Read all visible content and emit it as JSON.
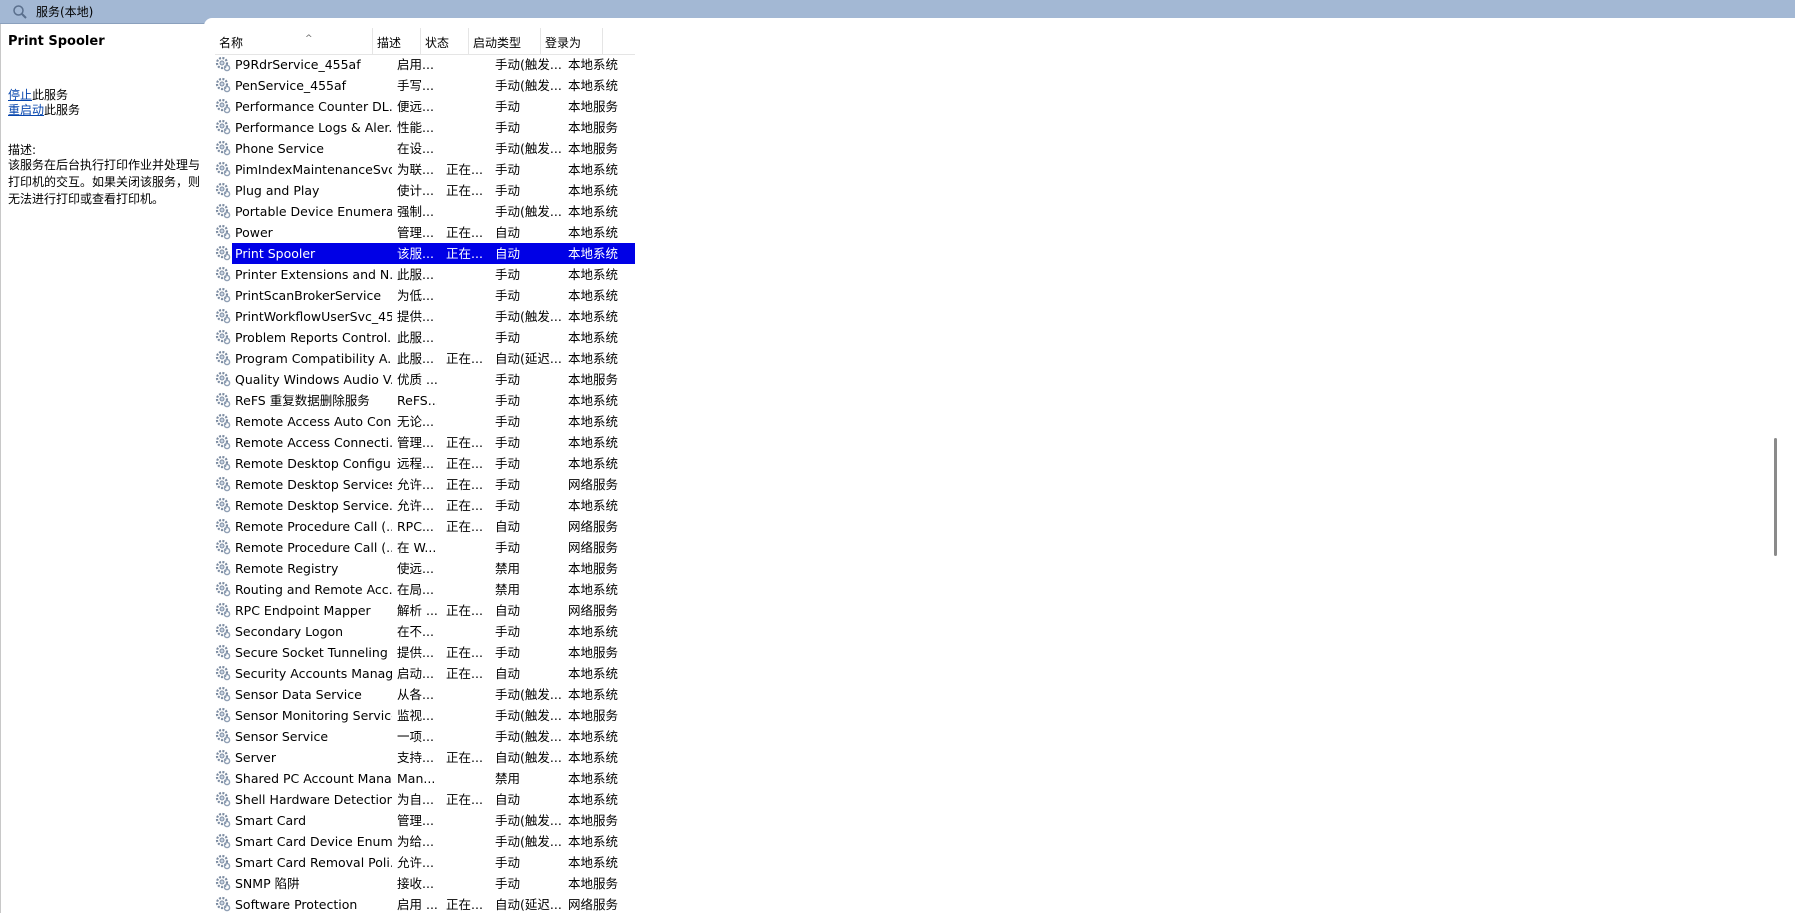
{
  "window": {
    "title": "服务(本地)"
  },
  "left_pane": {
    "title": "Print Spooler",
    "stop_link": "停止",
    "stop_suffix": "此服务",
    "restart_link": "重启动",
    "restart_suffix": "此服务",
    "description_label": "描述:",
    "description": "该服务在后台执行打印作业并处理与打印机的交互。如果关闭该服务，则无法进行打印或查看打印机。"
  },
  "table": {
    "columns": [
      "名称",
      "描述",
      "状态",
      "启动类型",
      "登录为"
    ],
    "selected_index": 9,
    "rows": [
      [
        "P9RdrService_455af",
        "启用...",
        "",
        "手动(触发...",
        "本地系统"
      ],
      [
        "PenService_455af",
        "手写...",
        "",
        "手动(触发...",
        "本地系统"
      ],
      [
        "Performance Counter DL...",
        "便远...",
        "",
        "手动",
        "本地服务"
      ],
      [
        "Performance Logs & Aler...",
        "性能...",
        "",
        "手动",
        "本地服务"
      ],
      [
        "Phone Service",
        "在设...",
        "",
        "手动(触发...",
        "本地服务"
      ],
      [
        "PimIndexMaintenanceSvc...",
        "为联...",
        "正在...",
        "手动",
        "本地系统"
      ],
      [
        "Plug and Play",
        "使计...",
        "正在...",
        "手动",
        "本地系统"
      ],
      [
        "Portable Device Enumera...",
        "强制...",
        "",
        "手动(触发...",
        "本地系统"
      ],
      [
        "Power",
        "管理...",
        "正在...",
        "自动",
        "本地系统"
      ],
      [
        "Print Spooler",
        "该服...",
        "正在...",
        "自动",
        "本地系统"
      ],
      [
        "Printer Extensions and N...",
        "此服...",
        "",
        "手动",
        "本地系统"
      ],
      [
        "PrintScanBrokerService",
        "为低...",
        "",
        "手动",
        "本地系统"
      ],
      [
        "PrintWorkflowUserSvc_45...",
        "提供...",
        "",
        "手动(触发...",
        "本地系统"
      ],
      [
        "Problem Reports Control...",
        "此服...",
        "",
        "手动",
        "本地系统"
      ],
      [
        "Program Compatibility A...",
        "此服...",
        "正在...",
        "自动(延迟...",
        "本地系统"
      ],
      [
        "Quality Windows Audio V...",
        "优质 ...",
        "",
        "手动",
        "本地服务"
      ],
      [
        "ReFS 重复数据删除服务",
        "ReFS...",
        "",
        "手动",
        "本地系统"
      ],
      [
        "Remote Access Auto Con...",
        "无论...",
        "",
        "手动",
        "本地系统"
      ],
      [
        "Remote Access Connecti...",
        "管理...",
        "正在...",
        "手动",
        "本地系统"
      ],
      [
        "Remote Desktop Configu...",
        "远程...",
        "正在...",
        "手动",
        "本地系统"
      ],
      [
        "Remote Desktop Services",
        "允许...",
        "正在...",
        "手动",
        "网络服务"
      ],
      [
        "Remote Desktop Service...",
        "允许...",
        "正在...",
        "手动",
        "本地系统"
      ],
      [
        "Remote Procedure Call (...",
        "RPC...",
        "正在...",
        "自动",
        "网络服务"
      ],
      [
        "Remote Procedure Call (...",
        "在 W...",
        "",
        "手动",
        "网络服务"
      ],
      [
        "Remote Registry",
        "使远...",
        "",
        "禁用",
        "本地服务"
      ],
      [
        "Routing and Remote Acc...",
        "在局...",
        "",
        "禁用",
        "本地系统"
      ],
      [
        "RPC Endpoint Mapper",
        "解析 ...",
        "正在...",
        "自动",
        "网络服务"
      ],
      [
        "Secondary Logon",
        "在不...",
        "",
        "手动",
        "本地系统"
      ],
      [
        "Secure Socket Tunneling ...",
        "提供...",
        "正在...",
        "手动",
        "本地服务"
      ],
      [
        "Security Accounts Manag...",
        "启动...",
        "正在...",
        "自动",
        "本地系统"
      ],
      [
        "Sensor Data Service",
        "从各...",
        "",
        "手动(触发...",
        "本地系统"
      ],
      [
        "Sensor Monitoring Service",
        "监视...",
        "",
        "手动(触发...",
        "本地服务"
      ],
      [
        "Sensor Service",
        "一项...",
        "",
        "手动(触发...",
        "本地系统"
      ],
      [
        "Server",
        "支持...",
        "正在...",
        "自动(触发...",
        "本地系统"
      ],
      [
        "Shared PC Account Mana...",
        "Man...",
        "",
        "禁用",
        "本地系统"
      ],
      [
        "Shell Hardware Detection",
        "为自...",
        "正在...",
        "自动",
        "本地系统"
      ],
      [
        "Smart Card",
        "管理...",
        "",
        "手动(触发...",
        "本地服务"
      ],
      [
        "Smart Card Device Enum...",
        "为给...",
        "",
        "手动(触发...",
        "本地系统"
      ],
      [
        "Smart Card Removal Poli...",
        "允许...",
        "",
        "手动",
        "本地系统"
      ],
      [
        "SNMP 陷阱",
        "接收...",
        "",
        "手动",
        "本地服务"
      ],
      [
        "Software Protection",
        "启用 ...",
        "正在...",
        "自动(延迟...",
        "网络服务"
      ]
    ]
  }
}
